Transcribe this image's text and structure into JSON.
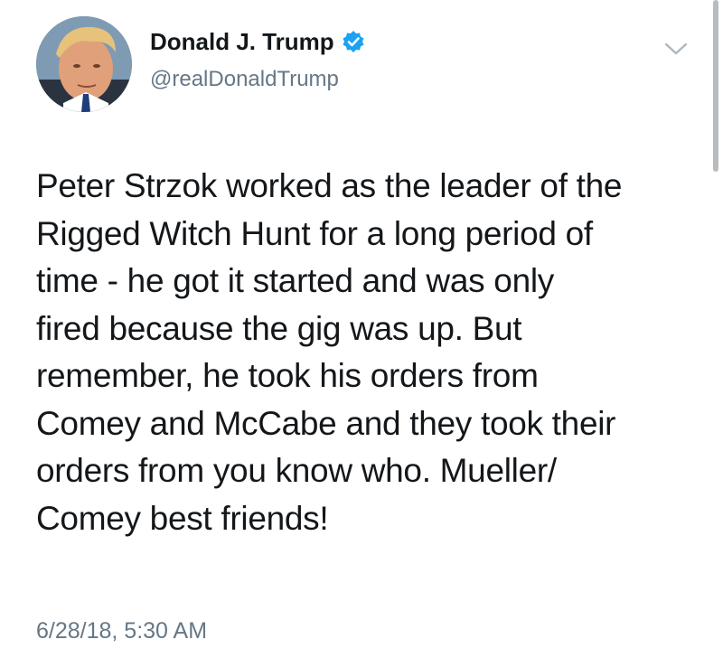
{
  "tweet": {
    "author": {
      "display_name": "Donald J. Trump",
      "handle": "@realDonaldTrump",
      "verified": true,
      "avatar_icon": "profile-photo"
    },
    "text_lines": [
      "Peter Strzok worked as the leader of the",
      "Rigged Witch Hunt for a long period of",
      "time - he got it started and was only",
      "fired because the gig was up. But",
      "remember, he took his orders from",
      "Comey and McCabe and they took their",
      "orders from you know who. Mueller/",
      "Comey best friends!"
    ],
    "timestamp": "6/28/18, 5:30 AM",
    "menu_icon": "chevron-down-icon"
  },
  "colors": {
    "text_primary": "#14171a",
    "text_secondary": "#657786",
    "verified_blue": "#1da1f2",
    "caret_gray": "#aab8c2"
  }
}
